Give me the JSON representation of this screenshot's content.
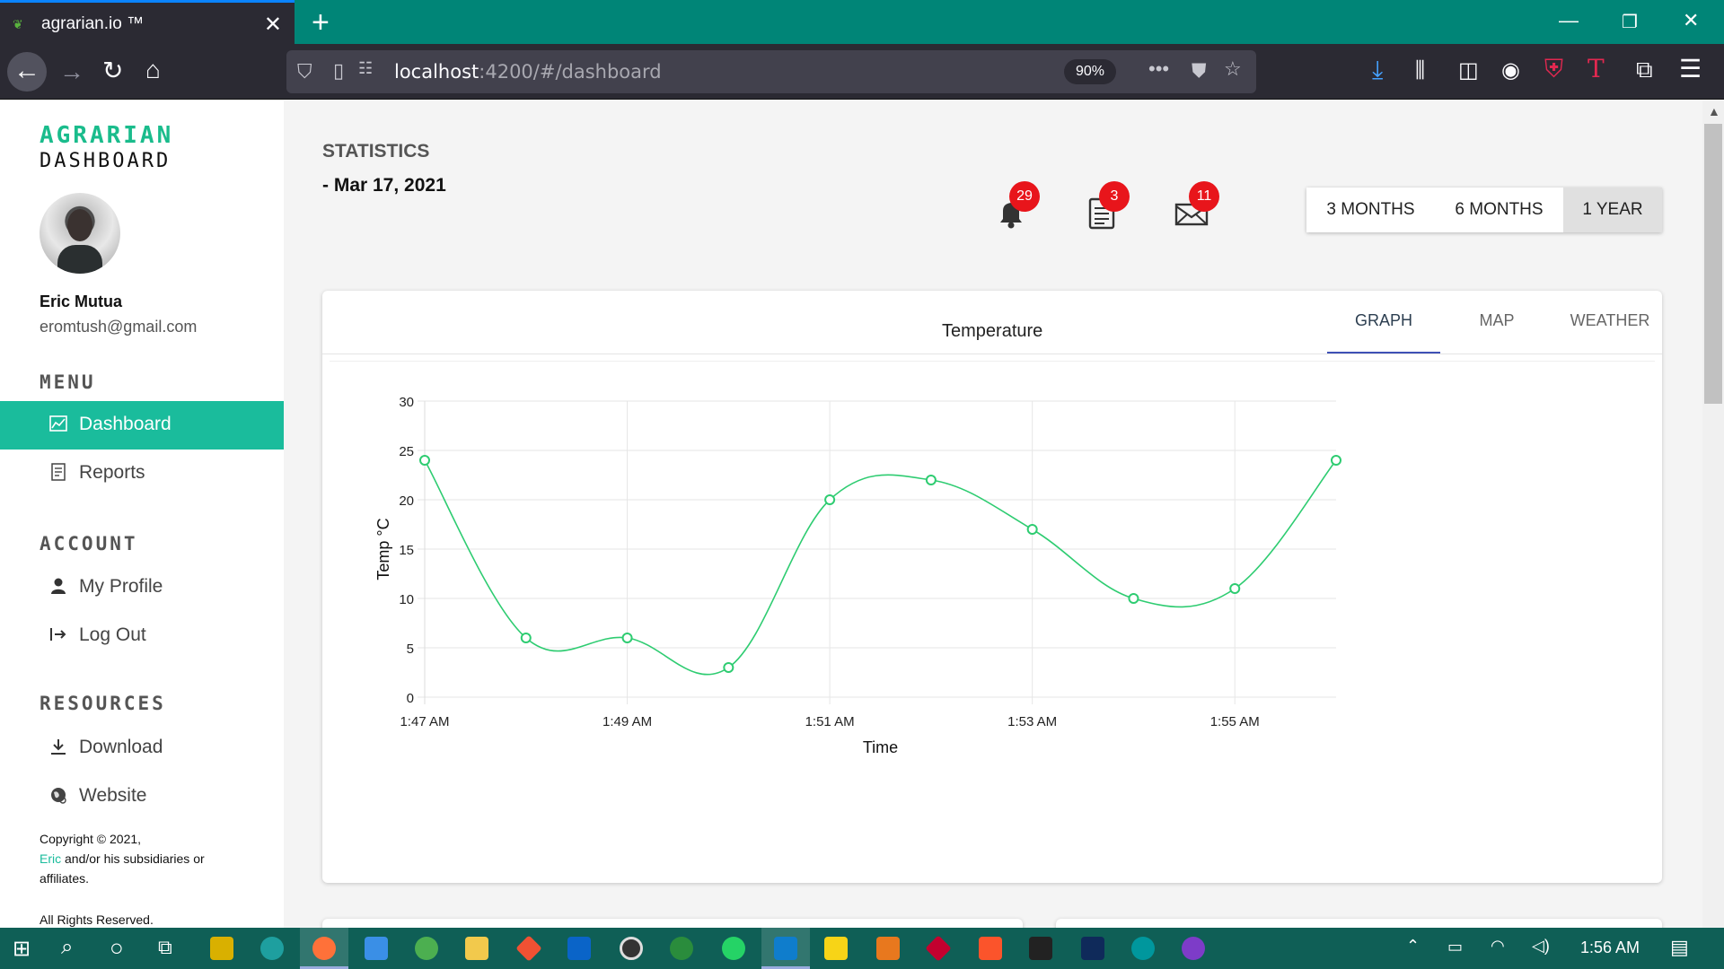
{
  "browser": {
    "tab_title": "agrarian.io ™",
    "url_host": "localhost",
    "url_path": ":4200/#/dashboard",
    "zoom": "90%"
  },
  "sidebar": {
    "brand_line1": "AGRARIAN",
    "brand_line2": "DASHBOARD",
    "user_name": "Eric Mutua",
    "user_email": "eromtush@gmail.com",
    "menu_heading": "MENU",
    "menu_items": [
      {
        "label": "Dashboard",
        "icon": "chart-icon",
        "active": true
      },
      {
        "label": "Reports",
        "icon": "report-icon",
        "active": false
      }
    ],
    "account_heading": "ACCOUNT",
    "account_items": [
      {
        "label": "My Profile",
        "icon": "user-icon"
      },
      {
        "label": "Log Out",
        "icon": "logout-icon"
      }
    ],
    "resources_heading": "RESOURCES",
    "resources_items": [
      {
        "label": "Download",
        "icon": "download-icon"
      },
      {
        "label": "Website",
        "icon": "globe-icon"
      }
    ],
    "copyright_line1": "Copyright © 2021,",
    "copyright_link": "Eric",
    "copyright_line2": " and/or his subsidiaries or affiliates.",
    "rights": "All Rights Reserved."
  },
  "header": {
    "title": "STATISTICS",
    "date": "- Mar 17, 2021",
    "notifications": {
      "alerts": "29",
      "reports": "3",
      "messages": "11"
    },
    "ranges": [
      "3 MONTHS",
      "6 MONTHS",
      "1 YEAR"
    ],
    "selected_range": "1 YEAR"
  },
  "card": {
    "title": "Temperature",
    "tabs": [
      "GRAPH",
      "MAP",
      "WEATHER"
    ],
    "selected_tab": "GRAPH"
  },
  "chart_data": {
    "type": "line",
    "title": "",
    "xlabel": "Time",
    "ylabel": "Temp °C",
    "ylim": [
      0,
      30
    ],
    "y_ticks": [
      0,
      5,
      10,
      15,
      20,
      25,
      30
    ],
    "x_tick_labels": [
      "1:47 AM",
      "1:49 AM",
      "1:51 AM",
      "1:53 AM",
      "1:55 AM"
    ],
    "x_tick_minutes": [
      0,
      2,
      4,
      6,
      8
    ],
    "x_range_minutes": [
      0,
      9
    ],
    "series": [
      {
        "color": "#2ecc71",
        "x_minutes": [
          0,
          1,
          2,
          3,
          4,
          5,
          6,
          7,
          8,
          9
        ],
        "values": [
          24,
          6,
          6,
          3,
          20,
          22,
          17,
          10,
          11,
          24
        ]
      }
    ],
    "grid": true
  },
  "taskbar": {
    "time": "1:56 AM"
  }
}
